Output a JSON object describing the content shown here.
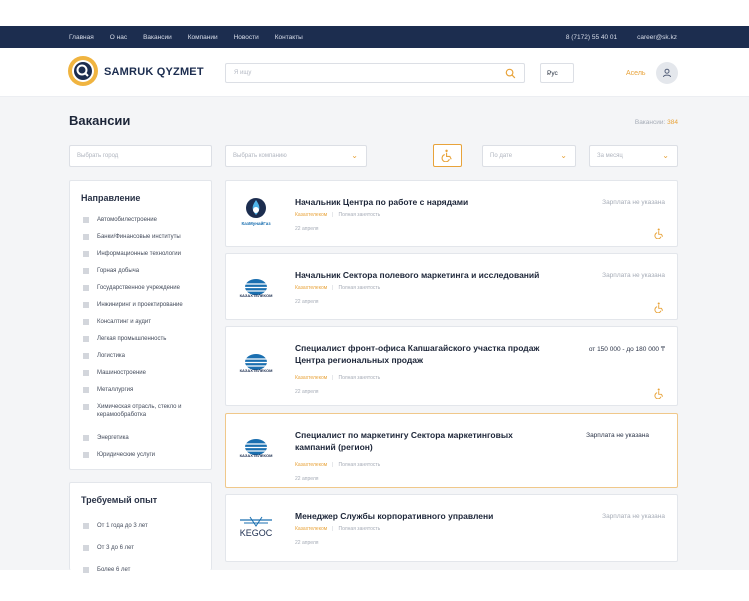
{
  "topbar": {
    "nav": [
      "Главная",
      "О нас",
      "Вакансии",
      "Компании",
      "Новости",
      "Контакты"
    ],
    "phone": "8 (7172) 55 40 01",
    "email": "career@sk.kz",
    "background": "#1c2d4f"
  },
  "header": {
    "brand": "SAMRUK QYZMET",
    "search_placeholder": "Я ищу",
    "language": "Рус",
    "user_name": "Асель"
  },
  "page": {
    "title": "Вакансии",
    "count_label": "Вакансии:",
    "count_value": "384"
  },
  "filters_bar": {
    "city_placeholder": "Выбрать город",
    "company_placeholder": "Выбрать компанию",
    "sort_placeholder": "По дате",
    "period_placeholder": "За месяц"
  },
  "direction": {
    "title": "Направление",
    "items": [
      "Автомобилестроение",
      "Банки/Финансовые институты",
      "Информационные технологии",
      "Горная добыча",
      "Государственное учреждение",
      "Инжиниринг и проектирование",
      "Консалтинг и аудит",
      "Легкая промышленность",
      "Логистика",
      "Машиностроение",
      "Металлургия",
      "Химическая отрасль, стекло и керамообработка",
      "Энергетика",
      "Юридические услуги"
    ]
  },
  "experience": {
    "title": "Требуемый опыт",
    "items": [
      "От 1 года до 3 лет",
      "От 3 до 6 лет",
      "Более 6 лет"
    ]
  },
  "vacancies": [
    {
      "title": "Начальник Центра по работе с нарядами",
      "company": "Казахтелеком",
      "employment": "Полная занятость",
      "date": "22 апреля",
      "salary": "Зарплата не указана",
      "logo": "kazmunaygas",
      "logo_text": "КазМунайГаз"
    },
    {
      "title": "Начальник Сектора полевого маркетинга и исследований",
      "company": "Казахтелеком",
      "employment": "Полная занятость",
      "date": "22 апреля",
      "salary": "Зарплата не указана",
      "logo": "kazakhtelecom",
      "logo_text": "КАЗАХТЕЛЕКОМ"
    },
    {
      "title_l1": "Специалист фронт-офиса Капшагайского участка продаж",
      "title_l2": "Центра региональных продаж",
      "company": "Казахтелеком",
      "employment": "Полная занятость",
      "date": "22 апреля",
      "salary": "от 150 000 - до 180 000 ₸",
      "logo": "kazakhtelecom",
      "logo_text": "КАЗАХТЕЛЕКОМ"
    },
    {
      "title_l1": "Специалист по маркетингу Сектора маркетинговых",
      "title_l2": "кампаний (регион)",
      "company": "Казахтелеком",
      "employment": "Полная занятость",
      "date": "22 апреля",
      "salary": "Зарплата не указана",
      "logo": "kazakhtelecom",
      "logo_text": "КАЗАХТЕЛЕКОМ"
    },
    {
      "title": "Менеджер Службы корпоративного управлени",
      "company": "Казахтелеком",
      "employment": "Полная занятость",
      "date": "22 апреля",
      "salary": "Зарплата не указана",
      "logo": "kegoc",
      "logo_text": "KEGOC"
    }
  ],
  "colors": {
    "accent": "#e8a33a",
    "navy": "#1c2d4f",
    "telecom_blue": "#1a6fb0"
  }
}
